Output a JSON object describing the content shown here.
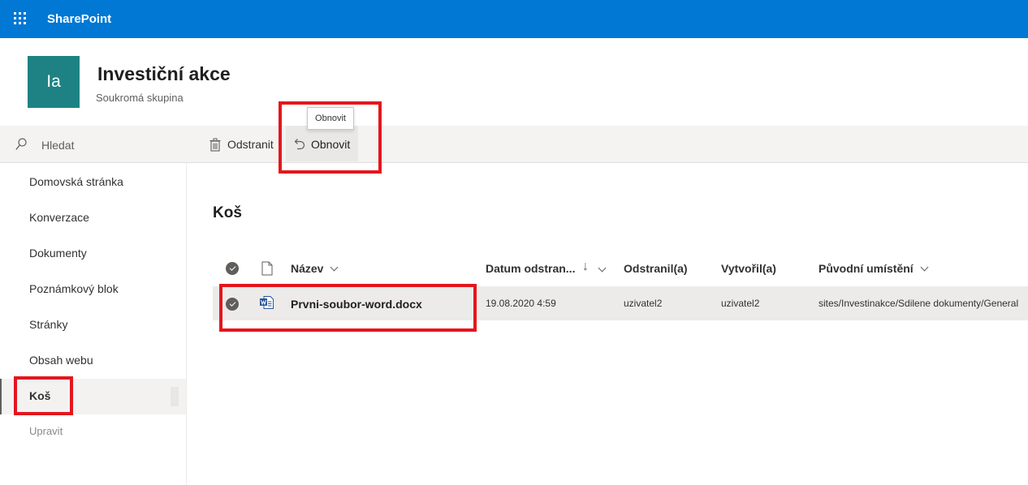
{
  "suite": {
    "app_name": "SharePoint"
  },
  "site": {
    "logo_text": "Ia",
    "title": "Investiční akce",
    "subtitle": "Soukromá skupina"
  },
  "search": {
    "placeholder": "Hledat"
  },
  "commands": {
    "delete_label": "Odstranit",
    "restore_label": "Obnovit",
    "tooltip": "Obnovit"
  },
  "nav": {
    "items": [
      {
        "label": "Domovská stránka"
      },
      {
        "label": "Konverzace"
      },
      {
        "label": "Dokumenty"
      },
      {
        "label": "Poznámkový blok"
      },
      {
        "label": "Stránky"
      },
      {
        "label": "Obsah webu"
      },
      {
        "label": "Koš",
        "active": true
      }
    ],
    "edit_label": "Upravit"
  },
  "main": {
    "heading": "Koš",
    "columns": {
      "name": "Název",
      "date_deleted": "Datum odstran...",
      "sort_arrow": "↓",
      "deleted_by": "Odstranil(a)",
      "created_by": "Vytvořil(a)",
      "original_location": "Původní umístění"
    },
    "rows": [
      {
        "name": "Prvni-soubor-word.docx",
        "date_deleted": "19.08.2020 4:59",
        "deleted_by": "uzivatel2",
        "created_by": "uzivatel2",
        "original_location": "sites/Investinakce/Sdilene dokumenty/General",
        "selected": true
      }
    ]
  },
  "colors": {
    "suite_bar": "#0078d4",
    "site_logo": "#1e8284",
    "annotation_red": "#e4161d"
  }
}
